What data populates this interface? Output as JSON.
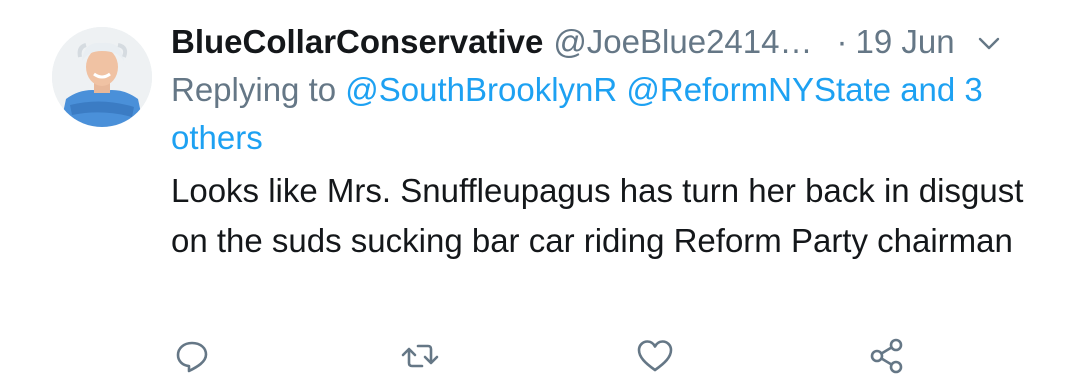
{
  "tweet": {
    "display_name": "BlueCollarConservative",
    "handle": "@JoeBlue2414…",
    "separator": "·",
    "date": "19 Jun",
    "replying_prefix": "Replying to",
    "reply_mentions": [
      "@SouthBrooklynR",
      "@ReformNYState"
    ],
    "reply_others": "and 3 others",
    "text": "Looks like Mrs. Snuffleupagus has turn her back in disgust on the suds sucking bar car riding Reform Party chairman"
  },
  "icons": {
    "caret": "chevron-down-icon",
    "reply": "reply-icon",
    "retweet": "retweet-icon",
    "like": "heart-icon",
    "share": "share-icon"
  },
  "colors": {
    "name": "#14171a",
    "secondary": "#657786",
    "link": "#1da1f2",
    "icon": "#657786"
  }
}
